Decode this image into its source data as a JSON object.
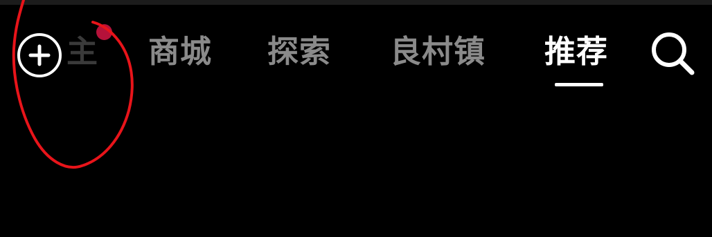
{
  "nav": {
    "add_icon": "plus-circle-icon",
    "partial_tab_label": "主",
    "badge_color": "#b5123a",
    "tabs": [
      {
        "label": "商城",
        "active": false
      },
      {
        "label": "探索",
        "active": false
      },
      {
        "label": "良村镇",
        "active": false
      },
      {
        "label": "推荐",
        "active": true
      }
    ],
    "search_icon": "search-icon"
  },
  "colors": {
    "background": "#000000",
    "active_tab": "#ffffff",
    "inactive_tab": "#8a8a8a",
    "annotation_stroke": "#e8141a"
  }
}
